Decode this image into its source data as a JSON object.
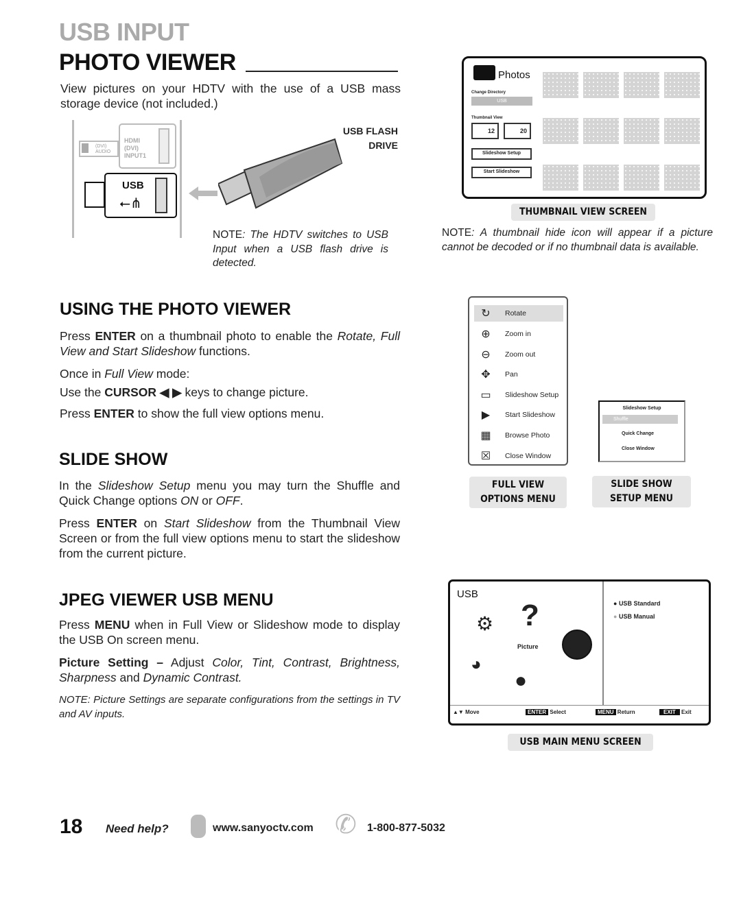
{
  "header": {
    "section": "USB INPUT",
    "title": "PHOTO VIEWER"
  },
  "intro": "View pictures on your HDTV with the use of a USB mass storage device (not included.)",
  "port_diagram": {
    "audio_label": "(DVI) AUDIO",
    "hdmi_label": "HDMI",
    "hdmi_sub": "(DVI) INPUT1",
    "usb_label": "USB",
    "flash_label_1": "USB FLASH",
    "flash_label_2": "DRIVE",
    "icons": [
      "speaker-icon",
      "usb-symbol-icon",
      "arrow-left-icon"
    ]
  },
  "note_usb": {
    "prefix": "NOTE",
    "text": ": The HDTV switches to USB Input when a USB flash drive is detected."
  },
  "thumbnail_screen": {
    "title": "Photos",
    "change_directory": "Change Directory",
    "directory_value": "USB",
    "thumbnail_view": "Thumbnail View",
    "options": [
      "12",
      "20"
    ],
    "slideshow_setup": "Slideshow Setup",
    "start_slideshow": "Start Slideshow",
    "caption": "THUMBNAIL VIEW SCREEN"
  },
  "note_thumb": {
    "prefix": "NOTE",
    "text": ": A thumbnail hide icon will appear if a picture cannot be decoded or if no thumbnail data is available."
  },
  "using": {
    "heading": "USING THE PHOTO VIEWER",
    "p1_a": "Press ",
    "p1_b": "ENTER",
    "p1_c": " on a thumbnail photo to enable the ",
    "p1_d": "Rotate, Full View and Start Slideshow",
    "p1_e": " functions.",
    "p2_a": "Once in ",
    "p2_b": "Full View",
    "p2_c": " mode:",
    "p3_a": "Use the ",
    "p3_b": "CURSOR ◀ ▶",
    "p3_c": " keys to change picture.",
    "p4_a": "Press ",
    "p4_b": "ENTER",
    "p4_c": " to show the full view options menu."
  },
  "full_view_menu": {
    "items": [
      {
        "label": "Rotate",
        "icon": "rotate-icon"
      },
      {
        "label": "Zoom in",
        "icon": "zoom-in-icon"
      },
      {
        "label": "Zoom out",
        "icon": "zoom-out-icon"
      },
      {
        "label": "Pan",
        "icon": "pan-icon"
      },
      {
        "label": "Slideshow Setup",
        "icon": "slideshow-setup-icon"
      },
      {
        "label": "Start Slideshow",
        "icon": "play-icon"
      },
      {
        "label": "Browse Photo",
        "icon": "grid-icon"
      },
      {
        "label": "Close Window",
        "icon": "close-icon"
      }
    ],
    "caption_1": "FULL VIEW",
    "caption_2": "OPTIONS MENU"
  },
  "slideshow_setup_menu": {
    "title": "Slideshow Setup",
    "items": [
      "Shuffle",
      "Quick Change",
      "Close Window"
    ],
    "caption_1": "SLIDE SHOW",
    "caption_2": "SETUP MENU"
  },
  "slideshow": {
    "heading": "SLIDE SHOW",
    "p1_a": "In the ",
    "p1_b": "Slideshow Setup",
    "p1_c": " menu you may turn the Shuffle and Quick Change options ",
    "p1_d": "ON",
    "p1_e": " or ",
    "p1_f": "OFF",
    "p1_g": ".",
    "p2_a": "Press ",
    "p2_b": "ENTER",
    "p2_c": " on ",
    "p2_d": "Start Slideshow",
    "p2_e": " from the Thumbnail View Screen or from the full view options menu to start the slideshow from the current picture."
  },
  "jpeg": {
    "heading": "JPEG VIEWER USB MENU",
    "p1_a": "Press ",
    "p1_b": "MENU",
    "p1_c": " when in Full View or Slideshow mode to display the USB On screen menu.",
    "p2_a": "Picture Setting –",
    "p2_b": " Adjust ",
    "p2_c": "Color, Tint, Contrast, Brightness, Sharpness",
    "p2_d": " and ",
    "p2_e": "Dynamic Contrast.",
    "note": "NOTE: Picture Settings are separate configurations from the settings in TV and AV inputs."
  },
  "usb_menu": {
    "title": "USB",
    "selected": "Picture",
    "options": [
      "USB Standard",
      "USB Manual"
    ],
    "footer": [
      {
        "key": "▲▼",
        "label": "Move"
      },
      {
        "key": "ENTER",
        "label": "Select"
      },
      {
        "key": "MENU",
        "label": "Return"
      },
      {
        "key": "EXIT",
        "label": "Exit"
      }
    ],
    "caption": "USB MAIN MENU SCREEN"
  },
  "footer": {
    "page": "18",
    "need_help": "Need help?",
    "website": "www.sanyoctv.com",
    "phone": "1-800-877-5032"
  }
}
